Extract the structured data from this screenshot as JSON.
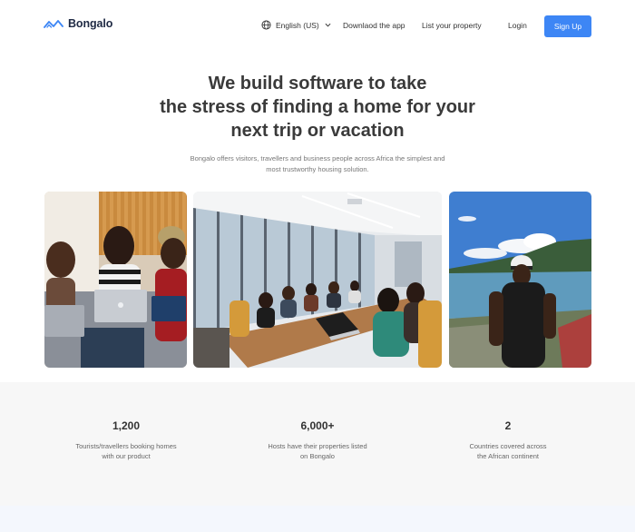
{
  "header": {
    "logo_text": "Bongalo",
    "language_label": "English (US)",
    "download_label": "Downlaod the app",
    "list_label": "List your property",
    "login_label": "Login",
    "signup_label": "Sign Up"
  },
  "hero": {
    "title_line1": "We build software to take",
    "title_line2": "the stress of finding a home for your",
    "title_line3": "next trip or vacation",
    "subtitle_line1": "Bongalo offers visitors, travellers and business people across Africa the simplest and",
    "subtitle_line2": "most trustworthy housing solution."
  },
  "stats": [
    {
      "number": "1,200",
      "desc_line1": "Tourists/travellers booking homes",
      "desc_line2": "with our product"
    },
    {
      "number": "6,000+",
      "desc_line1": "Hosts have their properties listed",
      "desc_line2": "on Bongalo"
    },
    {
      "number": "2",
      "desc_line1": "Countries covered across",
      "desc_line2": "the African continent"
    }
  ],
  "colors": {
    "accent": "#3d86f5",
    "logo": "#1f2a44",
    "stats_background": "#f7f7f7"
  },
  "icons": {
    "logo": "roof-wave-icon",
    "language": "globe-icon",
    "dropdown": "chevron-down-icon"
  }
}
